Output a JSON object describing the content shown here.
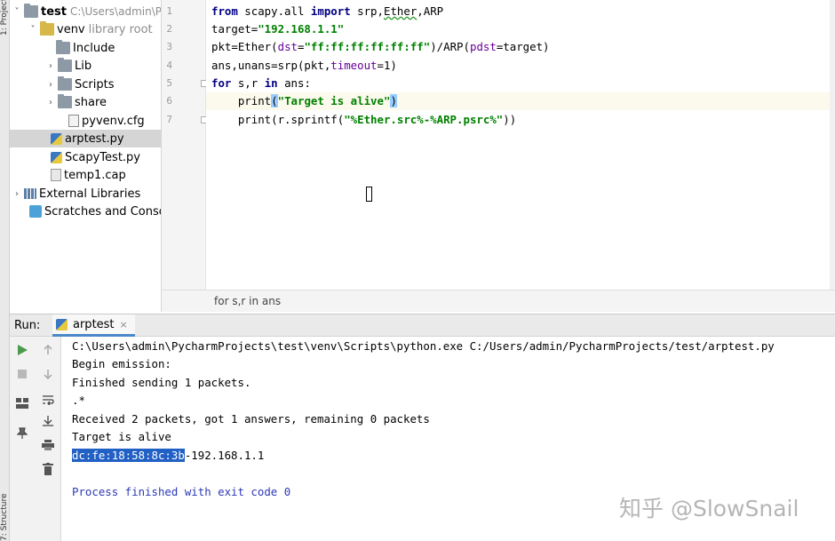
{
  "tool_strip": {
    "project_label": "1: Project",
    "structure_label": "7: Structure"
  },
  "project_tree": [
    {
      "arrow": "˅",
      "icon": "folder-icon",
      "label": "test",
      "hint": "C:\\Users\\admin\\P"
    },
    {
      "arrow": "˅",
      "icon": "folder-icon",
      "label": "venv",
      "hint": "library root"
    },
    {
      "arrow": "",
      "icon": "folder-icon",
      "label": "Include"
    },
    {
      "arrow": "›",
      "icon": "folder-icon",
      "label": "Lib"
    },
    {
      "arrow": "›",
      "icon": "folder-icon",
      "label": "Scripts"
    },
    {
      "arrow": "›",
      "icon": "folder-icon",
      "label": "share"
    },
    {
      "arrow": "",
      "icon": "config-file-icon",
      "label": "pyvenv.cfg"
    },
    {
      "arrow": "",
      "icon": "python-file-icon",
      "label": "arptest.py"
    },
    {
      "arrow": "",
      "icon": "python-file-icon",
      "label": "ScapyTest.py"
    },
    {
      "arrow": "",
      "icon": "capture-file-icon",
      "label": "temp1.cap"
    },
    {
      "arrow": "›",
      "icon": "libraries-icon",
      "label": "External Libraries"
    },
    {
      "arrow": "",
      "icon": "scratches-icon",
      "label": "Scratches and Consoles"
    }
  ],
  "editor": {
    "line_numbers": [
      "1",
      "2",
      "3",
      "4",
      "5",
      "6",
      "7"
    ],
    "lines": {
      "l1": {
        "kw1": "from",
        "mod": " scapy.all ",
        "kw2": "import",
        "rest1": " srp,",
        "ether": "Ether",
        "rest2": ",ARP"
      },
      "l2": {
        "lhs": "target=",
        "str": "\"192.168.1.1\""
      },
      "l3": {
        "a": "pkt=Ether(",
        "p1": "dst",
        "b": "=",
        "s1": "\"ff:ff:ff:ff:ff:ff\"",
        "c": ")/ARP(",
        "p2": "pdst",
        "d": "=target)"
      },
      "l4": {
        "a": "ans,unans=srp(pkt,",
        "p": "timeout",
        "b": "=1)"
      },
      "l5": {
        "kw1": "for",
        "a": " s,r ",
        "kw2": "in",
        "b": " ans:"
      },
      "l6": {
        "fn": "    print",
        "open": "(",
        "str": "\"Target is alive\"",
        "close": ")"
      },
      "l7": {
        "a": "    print(r.sprintf(",
        "str": "\"%Ether.src%-%ARP.psrc%\"",
        "b": "))"
      }
    },
    "breadcrumb": "for s,r in ans"
  },
  "run": {
    "label": "Run:",
    "tab_label": "arptest",
    "tab_close": "×",
    "console": {
      "cmd": "C:\\Users\\admin\\PycharmProjects\\test\\venv\\Scripts\\python.exe C:/Users/admin/PycharmProjects/test/arptest.py",
      "l2": "Begin emission:",
      "l3": "Finished sending 1 packets.",
      "l4": ".*",
      "l5": "Received 2 packets, got 1 answers, remaining 0 packets",
      "l6": "Target is alive",
      "l7_selected": "dc:fe:18:58:8c:3b",
      "l7_rest": "-192.168.1.1",
      "exit": "Process finished with exit code 0"
    }
  },
  "watermark": "知乎 @SlowSnail",
  "colors": {
    "keyword": "#000080",
    "string": "#008000",
    "param": "#660099",
    "selection": "#2160c4",
    "exit_message": "#2c39b5"
  }
}
